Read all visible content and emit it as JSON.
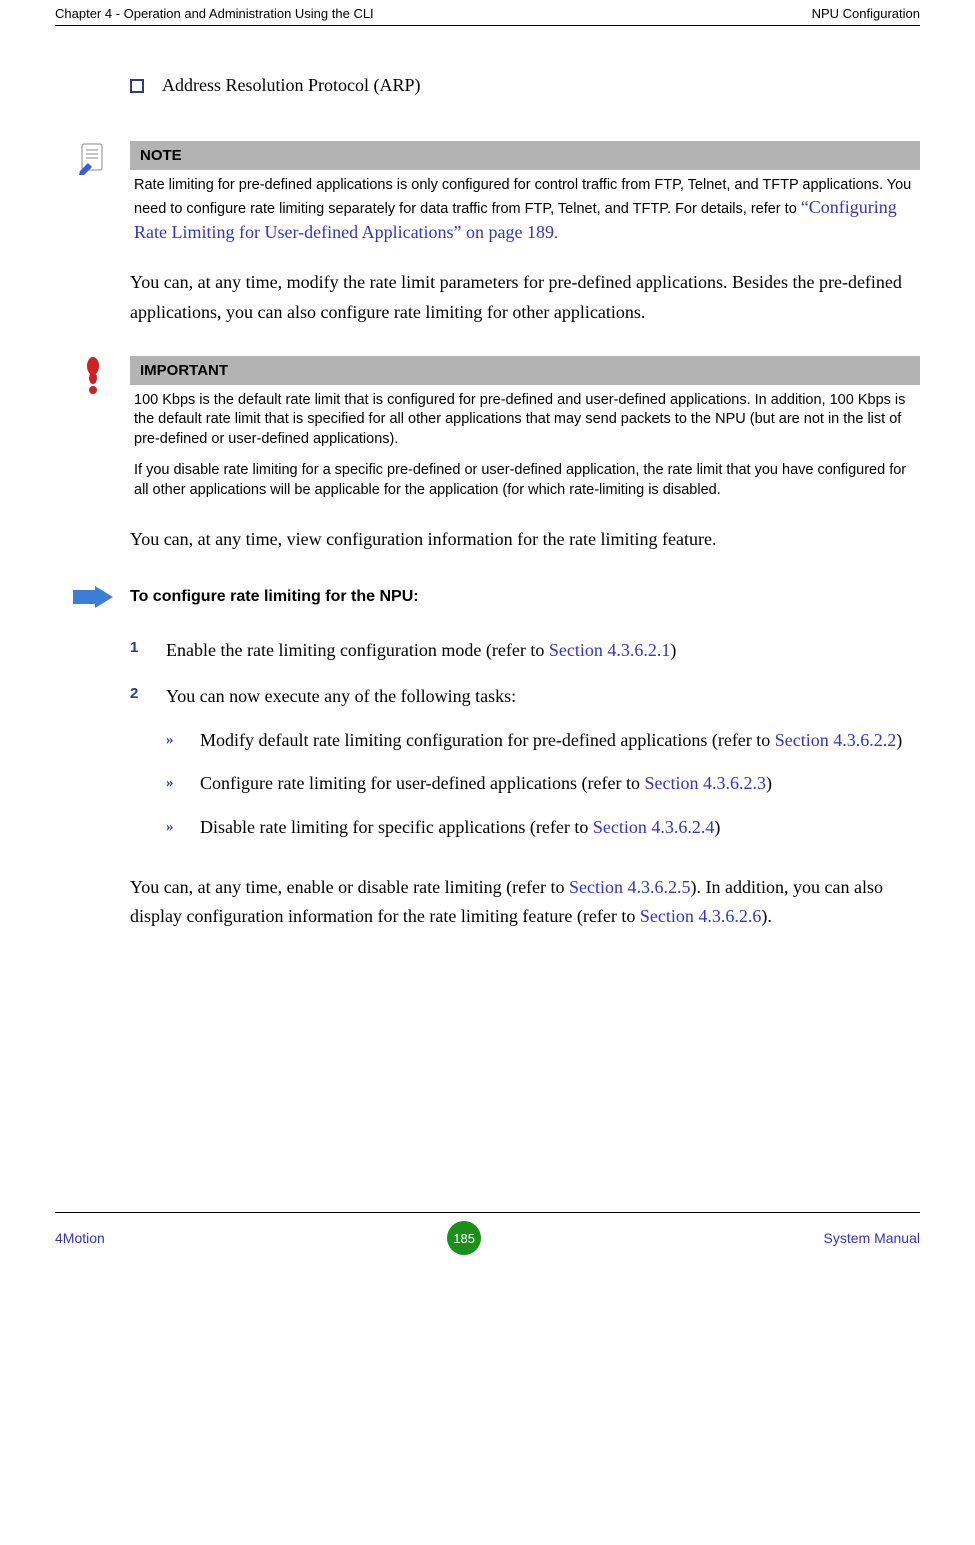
{
  "header": {
    "left": "Chapter 4 - Operation and Administration Using the CLI",
    "right": "NPU Configuration"
  },
  "bullet1": "Address Resolution Protocol (ARP)",
  "note": {
    "title": "NOTE",
    "text_plain": "Rate limiting for pre-defined applications is only configured for control traffic from FTP, Telnet, and TFTP applications. You need to configure rate limiting separately for data traffic from FTP, Telnet, and TFTP. For details, refer to ",
    "link": "“Configuring Rate Limiting for User-defined Applications” on page 189",
    "after": "."
  },
  "para1": "You can, at any time, modify the rate limit parameters for pre-defined applications. Besides the pre-defined applications, you can also configure rate limiting for other applications.",
  "important": {
    "title": "IMPORTANT",
    "p1": "100 Kbps is the default rate limit that is configured for pre-defined and user-defined applications. In addition, 100 Kbps is the default rate limit that is specified for all other applications that may send packets to the NPU (but are not in the list of pre-defined or user-defined applications).",
    "p2": "If you disable rate limiting for a specific pre-defined or user-defined application, the rate limit that you have configured for all other applications will be applicable for the application (for which rate-limiting is disabled."
  },
  "para2": "You can, at any time, view configuration information for the rate limiting feature.",
  "procedure_title": "To configure rate limiting for the NPU:",
  "steps": {
    "s1_num": "1",
    "s1_text_a": "Enable the rate limiting configuration mode (refer to ",
    "s1_link": "Section 4.3.6.2.1",
    "s1_text_b": ")",
    "s2_num": "2",
    "s2_text": "You can now execute any of the following tasks:",
    "sub1_a": "Modify default rate limiting configuration for pre-defined applications (refer to ",
    "sub1_link": "Section 4.3.6.2.2",
    "sub1_b": ")",
    "sub2_a": "Configure rate limiting for user-defined applications (refer to ",
    "sub2_link": "Section 4.3.6.2.3",
    "sub2_b": ")",
    "sub3_a": "Disable rate limiting for specific applications (refer to ",
    "sub3_link": "Section 4.3.6.2.4",
    "sub3_b": ")"
  },
  "para3_a": "You can, at any time, enable or disable rate limiting (refer to ",
  "para3_link1": "Section 4.3.6.2.5",
  "para3_b": "). In addition, you can also display configuration information for the rate limiting feature (refer to ",
  "para3_link2": "Section 4.3.6.2.6",
  "para3_c": ").",
  "footer": {
    "left": "4Motion",
    "page": "185",
    "right": "System Manual"
  }
}
